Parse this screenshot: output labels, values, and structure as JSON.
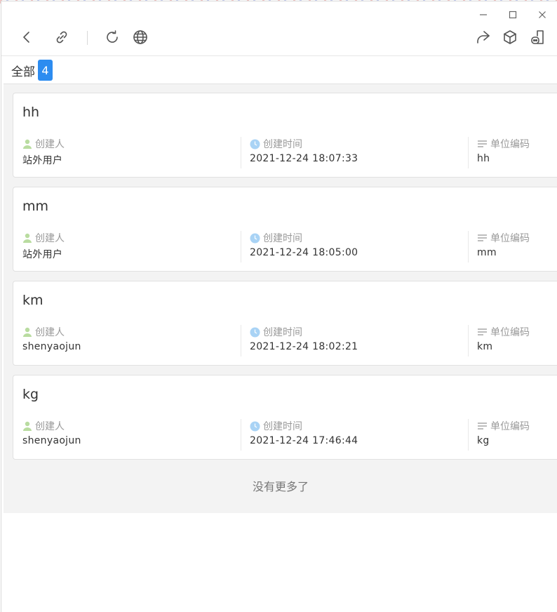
{
  "window": {
    "minimize_icon": "minimize-icon",
    "maximize_icon": "maximize-icon",
    "close_icon": "close-icon"
  },
  "toolbar": {
    "left_icons": [
      "back-icon",
      "link-icon",
      "refresh-icon",
      "globe-icon"
    ],
    "right_icons": [
      "share-icon",
      "cube-icon",
      "bot-icon"
    ]
  },
  "tabs": {
    "all_label": "全部",
    "all_count": "4"
  },
  "labels": {
    "creator": "创建人",
    "created_time": "创建时间",
    "unit_code": "单位编码"
  },
  "cards": [
    {
      "title": "hh",
      "creator": "站外用户",
      "created_time": "2021-12-24 18:07:33",
      "unit_code": "hh"
    },
    {
      "title": "mm",
      "creator": "站外用户",
      "created_time": "2021-12-24 18:05:00",
      "unit_code": "mm"
    },
    {
      "title": "km",
      "creator": "shenyaojun",
      "created_time": "2021-12-24 18:02:21",
      "unit_code": "km"
    },
    {
      "title": "kg",
      "creator": "shenyaojun",
      "created_time": "2021-12-24 17:46:44",
      "unit_code": "kg"
    }
  ],
  "footer": {
    "no_more": "没有更多了"
  },
  "colors": {
    "accent": "#2d8cf0",
    "user_icon": "#b9dca0",
    "clock_icon": "#a9d3f5",
    "list_icon": "#999999",
    "content_bg": "#f3f3f3"
  }
}
